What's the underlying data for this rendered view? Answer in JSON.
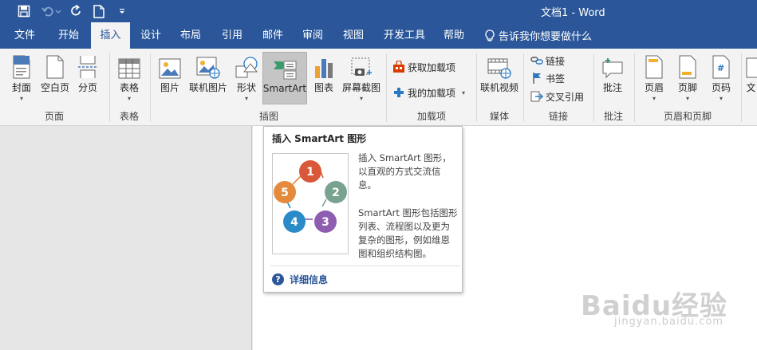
{
  "titlebar": {
    "title": "文档1 - Word"
  },
  "tabs": [
    {
      "label": "文件"
    },
    {
      "label": "开始"
    },
    {
      "label": "插入"
    },
    {
      "label": "设计"
    },
    {
      "label": "布局"
    },
    {
      "label": "引用"
    },
    {
      "label": "邮件"
    },
    {
      "label": "审阅"
    },
    {
      "label": "视图"
    },
    {
      "label": "开发工具"
    },
    {
      "label": "帮助"
    }
  ],
  "tell_me": "告诉我你想要做什么",
  "ribbon": {
    "pages": {
      "cover": "封面",
      "blank": "空白页",
      "break": "分页",
      "group": "页面"
    },
    "tables": {
      "table": "表格",
      "group": "表格"
    },
    "illustrations": {
      "picture": "图片",
      "online_picture": "联机图片",
      "shapes": "形状",
      "smartart": "SmartArt",
      "chart": "图表",
      "screenshot": "屏幕截图",
      "group": "插图"
    },
    "addins": {
      "get": "获取加载项",
      "mine": "我的加载项",
      "group": "加载项"
    },
    "media": {
      "online_video": "联机视频",
      "group": "媒体"
    },
    "links": {
      "link": "链接",
      "bookmark": "书签",
      "cross_ref": "交叉引用",
      "group": "链接"
    },
    "comments": {
      "comment": "批注",
      "group": "批注"
    },
    "header_footer": {
      "header": "页眉",
      "footer": "页脚",
      "page_number": "页码",
      "group": "页眉和页脚"
    },
    "text": {
      "partial": "文"
    }
  },
  "tooltip": {
    "title": "插入 SmartArt 图形",
    "desc1": "插入 SmartArt 图形，以直观的方式交流信息。",
    "desc2": "SmartArt 图形包括图形列表、流程图以及更为复杂的图形，例如维恩图和组织结构图。",
    "more": "详细信息",
    "diagram_numbers": [
      "1",
      "2",
      "3",
      "4",
      "5"
    ]
  },
  "watermark": {
    "main": "Baidu经验",
    "sub": "jingyan.baidu.com"
  },
  "colors": {
    "brand": "#2b579a",
    "ribbon_bg": "#f3f3f3"
  }
}
